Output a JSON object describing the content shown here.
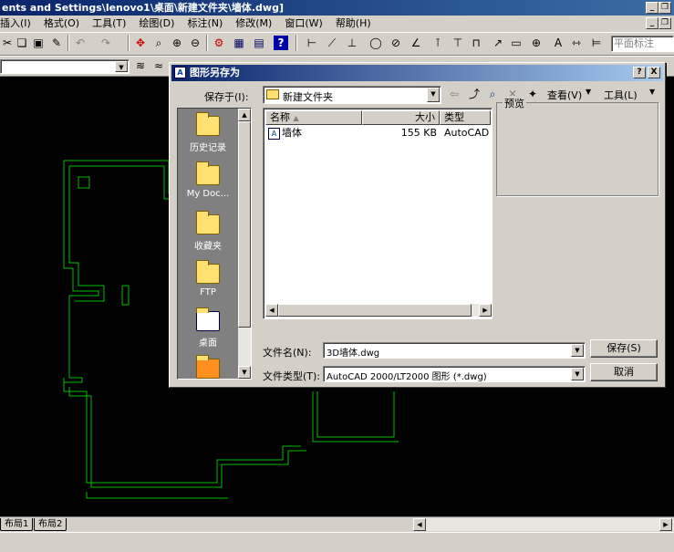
{
  "window": {
    "title": "ents and Settings\\lenovo1\\桌面\\新建文件夹\\墙体.dwg]"
  },
  "menu": {
    "items": [
      "插入(I)",
      "格式(O)",
      "工具(T)",
      "绘图(D)",
      "标注(N)",
      "修改(M)",
      "窗口(W)",
      "帮助(H)"
    ]
  },
  "toolbar": {
    "dim_style": "平面标注"
  },
  "layout_tabs": [
    "布局1",
    "布局2"
  ],
  "dialog": {
    "title": "图形另存为",
    "save_in_label": "保存于(I):",
    "save_in_value": "新建文件夹",
    "view_label": "查看(V)",
    "tools_label": "工具(L)",
    "places": [
      {
        "label": "历史记录",
        "icon": "history-folder-icon"
      },
      {
        "label": "My Doc...",
        "icon": "my-documents-folder-icon"
      },
      {
        "label": "收藏夹",
        "icon": "favorites-folder-icon"
      },
      {
        "label": "FTP",
        "icon": "ftp-folder-icon"
      },
      {
        "label": "桌面",
        "icon": "desktop-icon"
      }
    ],
    "columns": {
      "name": "名称",
      "size": "大小",
      "type": "类型"
    },
    "files": [
      {
        "name": "墙体",
        "size": "155 KB",
        "type": "AutoCAD 图"
      }
    ],
    "preview_label": "预览",
    "filename_label": "文件名(N):",
    "filename_value": "3D墙体.dwg",
    "filetype_label": "文件类型(T):",
    "filetype_value": "AutoCAD 2000/LT2000 图形 (*.dwg)",
    "save_button": "保存(S)",
    "cancel_button": "取消",
    "help_button": "?",
    "close_button": "X"
  }
}
